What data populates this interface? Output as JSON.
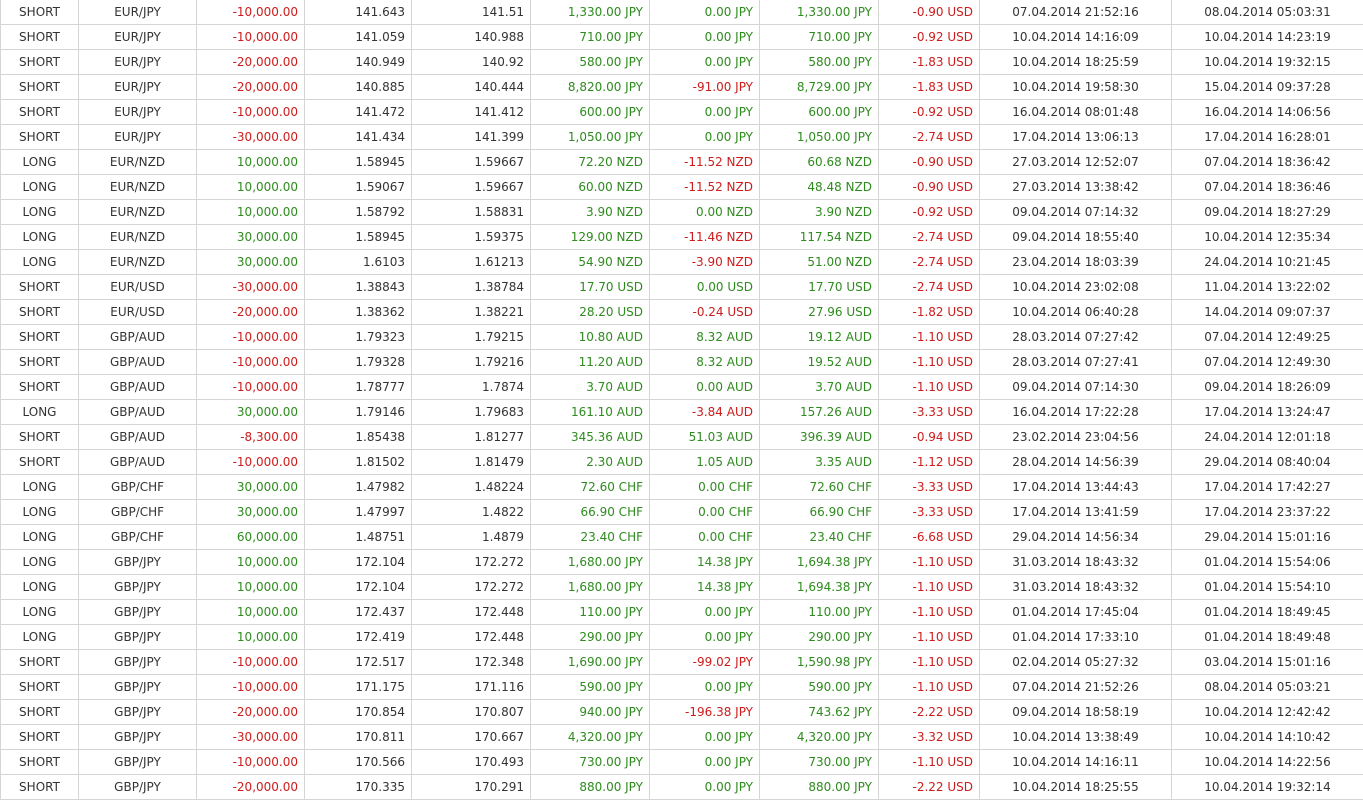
{
  "rows": [
    [
      "SHORT",
      "EUR/JPY",
      "-10,000.00",
      "141.643",
      "141.51",
      "1,330.00 JPY",
      "0.00 JPY",
      "1,330.00 JPY",
      "-0.90 USD",
      "07.04.2014 21:52:16",
      "08.04.2014 05:03:31"
    ],
    [
      "SHORT",
      "EUR/JPY",
      "-10,000.00",
      "141.059",
      "140.988",
      "710.00 JPY",
      "0.00 JPY",
      "710.00 JPY",
      "-0.92 USD",
      "10.04.2014 14:16:09",
      "10.04.2014 14:23:19"
    ],
    [
      "SHORT",
      "EUR/JPY",
      "-20,000.00",
      "140.949",
      "140.92",
      "580.00 JPY",
      "0.00 JPY",
      "580.00 JPY",
      "-1.83 USD",
      "10.04.2014 18:25:59",
      "10.04.2014 19:32:15"
    ],
    [
      "SHORT",
      "EUR/JPY",
      "-20,000.00",
      "140.885",
      "140.444",
      "8,820.00 JPY",
      "-91.00 JPY",
      "8,729.00 JPY",
      "-1.83 USD",
      "10.04.2014 19:58:30",
      "15.04.2014 09:37:28"
    ],
    [
      "SHORT",
      "EUR/JPY",
      "-10,000.00",
      "141.472",
      "141.412",
      "600.00 JPY",
      "0.00 JPY",
      "600.00 JPY",
      "-0.92 USD",
      "16.04.2014 08:01:48",
      "16.04.2014 14:06:56"
    ],
    [
      "SHORT",
      "EUR/JPY",
      "-30,000.00",
      "141.434",
      "141.399",
      "1,050.00 JPY",
      "0.00 JPY",
      "1,050.00 JPY",
      "-2.74 USD",
      "17.04.2014 13:06:13",
      "17.04.2014 16:28:01"
    ],
    [
      "LONG",
      "EUR/NZD",
      "10,000.00",
      "1.58945",
      "1.59667",
      "72.20 NZD",
      "-11.52 NZD",
      "60.68 NZD",
      "-0.90 USD",
      "27.03.2014 12:52:07",
      "07.04.2014 18:36:42"
    ],
    [
      "LONG",
      "EUR/NZD",
      "10,000.00",
      "1.59067",
      "1.59667",
      "60.00 NZD",
      "-11.52 NZD",
      "48.48 NZD",
      "-0.90 USD",
      "27.03.2014 13:38:42",
      "07.04.2014 18:36:46"
    ],
    [
      "LONG",
      "EUR/NZD",
      "10,000.00",
      "1.58792",
      "1.58831",
      "3.90 NZD",
      "0.00 NZD",
      "3.90 NZD",
      "-0.92 USD",
      "09.04.2014 07:14:32",
      "09.04.2014 18:27:29"
    ],
    [
      "LONG",
      "EUR/NZD",
      "30,000.00",
      "1.58945",
      "1.59375",
      "129.00 NZD",
      "-11.46 NZD",
      "117.54 NZD",
      "-2.74 USD",
      "09.04.2014 18:55:40",
      "10.04.2014 12:35:34"
    ],
    [
      "LONG",
      "EUR/NZD",
      "30,000.00",
      "1.6103",
      "1.61213",
      "54.90 NZD",
      "-3.90 NZD",
      "51.00 NZD",
      "-2.74 USD",
      "23.04.2014 18:03:39",
      "24.04.2014 10:21:45"
    ],
    [
      "SHORT",
      "EUR/USD",
      "-30,000.00",
      "1.38843",
      "1.38784",
      "17.70 USD",
      "0.00 USD",
      "17.70 USD",
      "-2.74 USD",
      "10.04.2014 23:02:08",
      "11.04.2014 13:22:02"
    ],
    [
      "SHORT",
      "EUR/USD",
      "-20,000.00",
      "1.38362",
      "1.38221",
      "28.20 USD",
      "-0.24 USD",
      "27.96 USD",
      "-1.82 USD",
      "10.04.2014 06:40:28",
      "14.04.2014 09:07:37"
    ],
    [
      "SHORT",
      "GBP/AUD",
      "-10,000.00",
      "1.79323",
      "1.79215",
      "10.80 AUD",
      "8.32 AUD",
      "19.12 AUD",
      "-1.10 USD",
      "28.03.2014 07:27:42",
      "07.04.2014 12:49:25"
    ],
    [
      "SHORT",
      "GBP/AUD",
      "-10,000.00",
      "1.79328",
      "1.79216",
      "11.20 AUD",
      "8.32 AUD",
      "19.52 AUD",
      "-1.10 USD",
      "28.03.2014 07:27:41",
      "07.04.2014 12:49:30"
    ],
    [
      "SHORT",
      "GBP/AUD",
      "-10,000.00",
      "1.78777",
      "1.7874",
      "3.70 AUD",
      "0.00 AUD",
      "3.70 AUD",
      "-1.10 USD",
      "09.04.2014 07:14:30",
      "09.04.2014 18:26:09"
    ],
    [
      "LONG",
      "GBP/AUD",
      "30,000.00",
      "1.79146",
      "1.79683",
      "161.10 AUD",
      "-3.84 AUD",
      "157.26 AUD",
      "-3.33 USD",
      "16.04.2014 17:22:28",
      "17.04.2014 13:24:47"
    ],
    [
      "SHORT",
      "GBP/AUD",
      "-8,300.00",
      "1.85438",
      "1.81277",
      "345.36 AUD",
      "51.03 AUD",
      "396.39 AUD",
      "-0.94 USD",
      "23.02.2014 23:04:56",
      "24.04.2014 12:01:18"
    ],
    [
      "SHORT",
      "GBP/AUD",
      "-10,000.00",
      "1.81502",
      "1.81479",
      "2.30 AUD",
      "1.05 AUD",
      "3.35 AUD",
      "-1.12 USD",
      "28.04.2014 14:56:39",
      "29.04.2014 08:40:04"
    ],
    [
      "LONG",
      "GBP/CHF",
      "30,000.00",
      "1.47982",
      "1.48224",
      "72.60 CHF",
      "0.00 CHF",
      "72.60 CHF",
      "-3.33 USD",
      "17.04.2014 13:44:43",
      "17.04.2014 17:42:27"
    ],
    [
      "LONG",
      "GBP/CHF",
      "30,000.00",
      "1.47997",
      "1.4822",
      "66.90 CHF",
      "0.00 CHF",
      "66.90 CHF",
      "-3.33 USD",
      "17.04.2014 13:41:59",
      "17.04.2014 23:37:22"
    ],
    [
      "LONG",
      "GBP/CHF",
      "60,000.00",
      "1.48751",
      "1.4879",
      "23.40 CHF",
      "0.00 CHF",
      "23.40 CHF",
      "-6.68 USD",
      "29.04.2014 14:56:34",
      "29.04.2014 15:01:16"
    ],
    [
      "LONG",
      "GBP/JPY",
      "10,000.00",
      "172.104",
      "172.272",
      "1,680.00 JPY",
      "14.38 JPY",
      "1,694.38 JPY",
      "-1.10 USD",
      "31.03.2014 18:43:32",
      "01.04.2014 15:54:06"
    ],
    [
      "LONG",
      "GBP/JPY",
      "10,000.00",
      "172.104",
      "172.272",
      "1,680.00 JPY",
      "14.38 JPY",
      "1,694.38 JPY",
      "-1.10 USD",
      "31.03.2014 18:43:32",
      "01.04.2014 15:54:10"
    ],
    [
      "LONG",
      "GBP/JPY",
      "10,000.00",
      "172.437",
      "172.448",
      "110.00 JPY",
      "0.00 JPY",
      "110.00 JPY",
      "-1.10 USD",
      "01.04.2014 17:45:04",
      "01.04.2014 18:49:45"
    ],
    [
      "LONG",
      "GBP/JPY",
      "10,000.00",
      "172.419",
      "172.448",
      "290.00 JPY",
      "0.00 JPY",
      "290.00 JPY",
      "-1.10 USD",
      "01.04.2014 17:33:10",
      "01.04.2014 18:49:48"
    ],
    [
      "SHORT",
      "GBP/JPY",
      "-10,000.00",
      "172.517",
      "172.348",
      "1,690.00 JPY",
      "-99.02 JPY",
      "1,590.98 JPY",
      "-1.10 USD",
      "02.04.2014 05:27:32",
      "03.04.2014 15:01:16"
    ],
    [
      "SHORT",
      "GBP/JPY",
      "-10,000.00",
      "171.175",
      "171.116",
      "590.00 JPY",
      "0.00 JPY",
      "590.00 JPY",
      "-1.10 USD",
      "07.04.2014 21:52:26",
      "08.04.2014 05:03:21"
    ],
    [
      "SHORT",
      "GBP/JPY",
      "-20,000.00",
      "170.854",
      "170.807",
      "940.00 JPY",
      "-196.38 JPY",
      "743.62 JPY",
      "-2.22 USD",
      "09.04.2014 18:58:19",
      "10.04.2014 12:42:42"
    ],
    [
      "SHORT",
      "GBP/JPY",
      "-30,000.00",
      "170.811",
      "170.667",
      "4,320.00 JPY",
      "0.00 JPY",
      "4,320.00 JPY",
      "-3.32 USD",
      "10.04.2014 13:38:49",
      "10.04.2014 14:10:42"
    ],
    [
      "SHORT",
      "GBP/JPY",
      "-10,000.00",
      "170.566",
      "170.493",
      "730.00 JPY",
      "0.00 JPY",
      "730.00 JPY",
      "-1.10 USD",
      "10.04.2014 14:16:11",
      "10.04.2014 14:22:56"
    ],
    [
      "SHORT",
      "GBP/JPY",
      "-20,000.00",
      "170.335",
      "170.291",
      "880.00 JPY",
      "0.00 JPY",
      "880.00 JPY",
      "-2.22 USD",
      "10.04.2014 18:25:55",
      "10.04.2014 19:32:14"
    ]
  ],
  "colors": {
    "positive": "#2e8b1e",
    "negative": "#cc1c1c",
    "neutral": "#333333",
    "grid": "#d4d4d4"
  }
}
